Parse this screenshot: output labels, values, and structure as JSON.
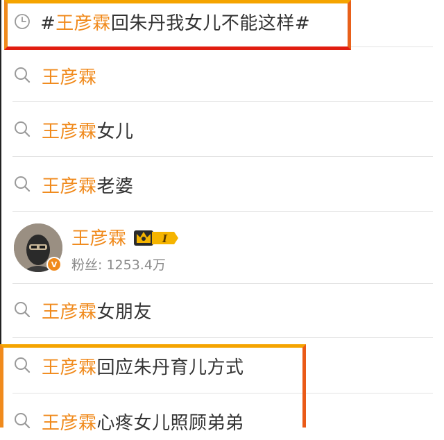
{
  "history_item": {
    "icon": "clock-icon",
    "prefix": "#",
    "highlight": "王彦霖",
    "rest": "回朱丹我女儿不能这样#"
  },
  "suggestions": [
    {
      "icon": "search-icon",
      "highlight": "王彦霖",
      "rest": ""
    },
    {
      "icon": "search-icon",
      "highlight": "王彦霖",
      "rest": "女儿"
    },
    {
      "icon": "search-icon",
      "highlight": "王彦霖",
      "rest": "老婆"
    }
  ],
  "user_card": {
    "name": "王彦霖",
    "fans_label": "粉丝: 1253.4万",
    "level_badge": "I",
    "verified_icon": "v-verified-icon",
    "crown_icon": "crown-icon"
  },
  "suggestions_after": [
    {
      "icon": "search-icon",
      "highlight": "王彦霖",
      "rest": "女朋友"
    },
    {
      "icon": "search-icon",
      "highlight": "王彦霖",
      "rest": "回应朱丹育儿方式"
    },
    {
      "icon": "search-icon",
      "highlight": "王彦霖",
      "rest": "心疼女儿照顾弟弟"
    }
  ],
  "colors": {
    "highlight": "#f08a1c",
    "text": "#333333",
    "muted": "#8a8a8a",
    "frame_orange": "#f08a1c",
    "frame_red": "#e11d10"
  }
}
